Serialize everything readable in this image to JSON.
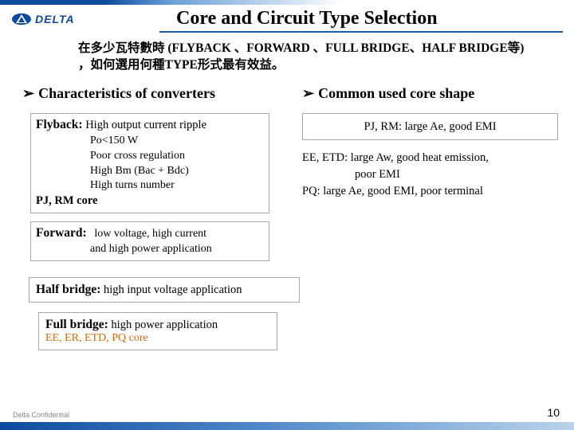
{
  "logo": {
    "text": "DELTA"
  },
  "title": "Core and Circuit Type Selection",
  "subtitle": "在多少瓦特數時 (FLYBACK 、FORWARD 、FULL BRIDGE、HALF BRIDGE等) ，如何選用何種TYPE形式最有效益。",
  "left": {
    "heading": "Characteristics of converters",
    "flyback": {
      "lead": "Flyback:",
      "l1": "High output current ripple",
      "l2": "Po<150 W",
      "l3": "Poor cross regulation",
      "l4": "High Bm (Bac + Bdc)",
      "l5": "High turns number",
      "core": "PJ, RM core"
    },
    "forward": {
      "lead": "Forward:",
      "l1": "low voltage, high current",
      "l2": "and high power application"
    },
    "half": {
      "lead": "Half bridge:",
      "rest": "high input voltage application"
    },
    "full": {
      "lead": "Full bridge:",
      "rest": "high power application",
      "core": "EE, ER, ETD, PQ core"
    }
  },
  "right": {
    "heading": "Common used core shape",
    "box": "PJ, RM: large Ae, good EMI",
    "n1": "EE, ETD: large Aw, good heat emission,",
    "n2": "poor EMI",
    "n3": "PQ: large Ae, good EMI, poor terminal"
  },
  "footer": {
    "confidential": "Delta Confidential",
    "page": "10"
  }
}
